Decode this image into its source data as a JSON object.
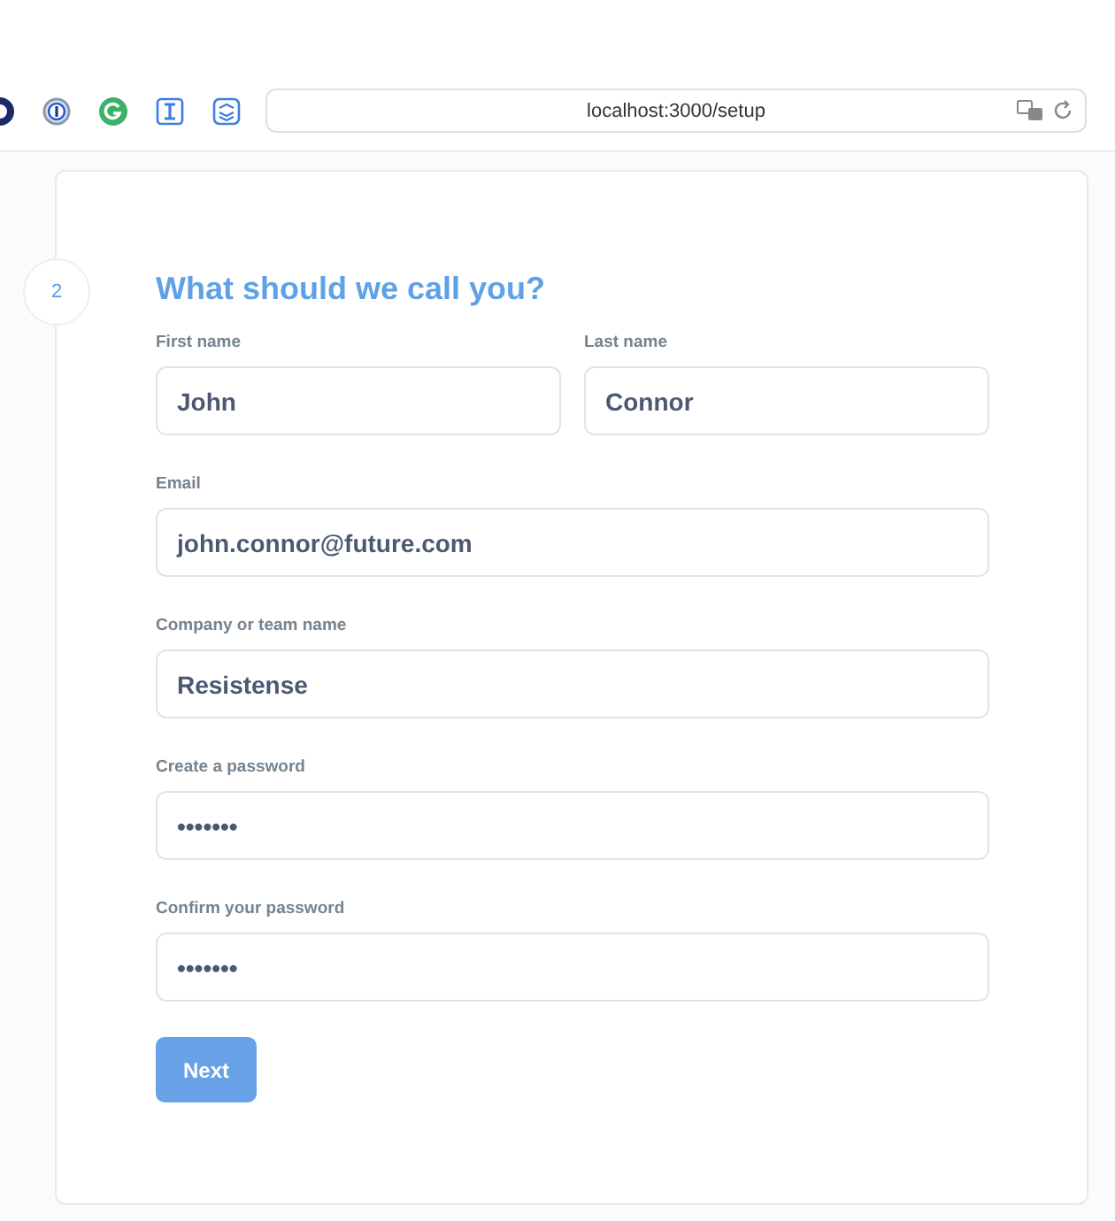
{
  "browser": {
    "address": "localhost:3000/setup"
  },
  "step": {
    "number": "2",
    "title": "What should we call you?"
  },
  "rows": [
    [
      {
        "label": "First name",
        "value": "John"
      },
      {
        "label": "Last name",
        "value": "Connor"
      }
    ],
    [
      {
        "label": "Email",
        "value": "john.connor@future.com"
      }
    ],
    [
      {
        "label": "Company or team name",
        "value": "Resistense"
      }
    ],
    [
      {
        "label": "Create a password",
        "value": "•••••••"
      }
    ],
    [
      {
        "label": "Confirm your password",
        "value": "•••••••"
      }
    ]
  ],
  "button": {
    "label": "Next"
  }
}
